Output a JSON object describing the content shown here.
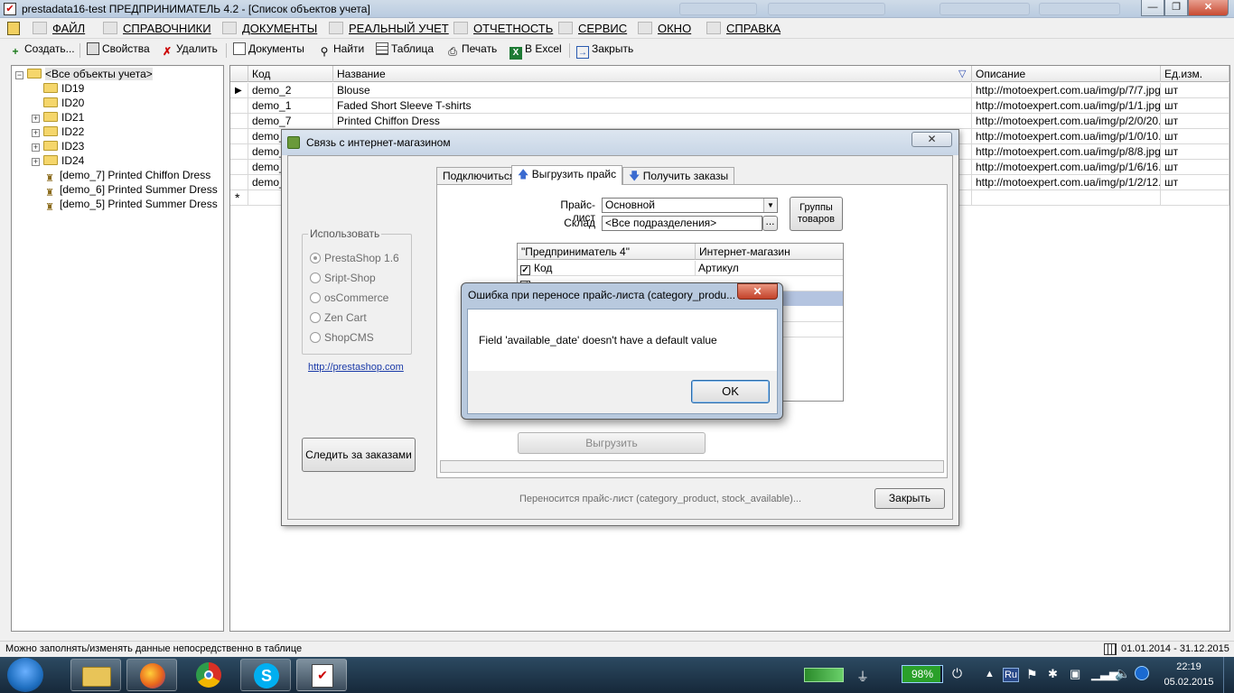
{
  "window": {
    "title": "prestadata16-test  ПРЕДПРИНИМАТЕЛЬ 4.2 - [Список объектов учета]",
    "controls": [
      "minimize",
      "maximize",
      "close"
    ]
  },
  "menu": {
    "items": [
      "ФАЙЛ",
      "СПРАВОЧНИКИ",
      "ДОКУМЕНТЫ",
      "РЕАЛЬНЫЙ УЧЕТ",
      "ОТЧЕТНОСТЬ",
      "СЕРВИС",
      "ОКНО",
      "СПРАВКА"
    ]
  },
  "toolbar": {
    "create": "Создать...",
    "properties": "Свойства",
    "delete": "Удалить",
    "documents": "Документы",
    "find": "Найти",
    "table": "Таблица",
    "print": "Печать",
    "excel": "В Excel",
    "close": "Закрыть"
  },
  "tree": {
    "root": "<Все объекты учета>",
    "nodes": [
      {
        "label": "ID19",
        "expandable": false
      },
      {
        "label": "ID20",
        "expandable": false
      },
      {
        "label": "ID21",
        "expandable": true
      },
      {
        "label": "ID22",
        "expandable": true
      },
      {
        "label": "ID23",
        "expandable": true
      },
      {
        "label": "ID24",
        "expandable": true
      }
    ],
    "leaves": [
      "[demo_7]  Printed Chiffon Dress",
      "[demo_6]  Printed Summer Dress",
      "[demo_5]  Printed Summer Dress"
    ]
  },
  "grid": {
    "columns": {
      "code": "Код",
      "name": "Название",
      "description": "Описание",
      "unit": "Ед.изм."
    },
    "rows": [
      {
        "code": "demo_2",
        "name": "Blouse",
        "desc": "http://motoexpert.com.ua/img/p/7/7.jpg",
        "unit": "шт"
      },
      {
        "code": "demo_1",
        "name": "Faded Short Sleeve T-shirts",
        "desc": "http://motoexpert.com.ua/img/p/1/1.jpg",
        "unit": "шт"
      },
      {
        "code": "demo_7",
        "name": "Printed Chiffon Dress",
        "desc": "http://motoexpert.com.ua/img/p/2/0/20.jp",
        "unit": "шт"
      },
      {
        "code": "demo_",
        "name": "",
        "desc": "http://motoexpert.com.ua/img/p/1/0/10.jp",
        "unit": "шт"
      },
      {
        "code": "demo_",
        "name": "",
        "desc": "http://motoexpert.com.ua/img/p/8/8.jpg",
        "unit": "шт"
      },
      {
        "code": "demo_",
        "name": "",
        "desc": "http://motoexpert.com.ua/img/p/1/6/16.jp",
        "unit": "шт"
      },
      {
        "code": "demo_",
        "name": "",
        "desc": "http://motoexpert.com.ua/img/p/1/2/12.jp",
        "unit": "шт"
      }
    ],
    "new_row_marker": "*",
    "current_row_marker": "▶"
  },
  "shop_dialog": {
    "title": "Связь с интернет-магазином",
    "close_glyph": "✕",
    "use_group": "Использовать",
    "platforms": [
      {
        "label": "PrestaShop 1.6",
        "selected": true
      },
      {
        "label": "Sript-Shop",
        "selected": false
      },
      {
        "label": "osCommerce",
        "selected": false
      },
      {
        "label": "Zen Cart",
        "selected": false
      },
      {
        "label": "ShopCMS",
        "selected": false
      }
    ],
    "link": "http://prestashop.com",
    "track_orders": "Следить за заказами",
    "tabs": [
      "Подключиться",
      "Выгрузить прайс",
      "Получить заказы"
    ],
    "active_tab": "Выгрузить прайс",
    "pricelist_label": "Прайс-лист",
    "pricelist_value": "Основной",
    "warehouse_label": "Склад",
    "warehouse_value": "<Все подразделения>",
    "warehouse_btn": "...",
    "groups_btn_line1": "Группы",
    "groups_btn_line2": "товаров",
    "map_header_left": "\"Предприниматель 4\"",
    "map_header_right": "Интернет-магазин",
    "map_rows": [
      {
        "left": "Код",
        "right": "Артикул",
        "checked": true
      }
    ],
    "export_btn": "Выгрузить",
    "status_text": "Переносится прайс-лист (category_product, stock_available)...",
    "close_btn": "Закрыть"
  },
  "error_dialog": {
    "title": "Ошибка при переносе прайс-листа (category_produ...",
    "close_glyph": "✕",
    "message": "Field 'available_date' doesn't have a default value",
    "ok": "OK"
  },
  "statusbar": {
    "hint": "Можно заполнять/изменять данные непосредственно в таблице",
    "period": "01.01.2014 - 31.12.2015"
  },
  "taskbar": {
    "battery": "98%",
    "language": "Ru",
    "time": "22:19",
    "date": "05.02.2015",
    "colors": {
      "start": "#1f6fc0",
      "firefox": "#e8661c",
      "chrome": "#2e9c4a",
      "skype": "#00aff0"
    }
  }
}
